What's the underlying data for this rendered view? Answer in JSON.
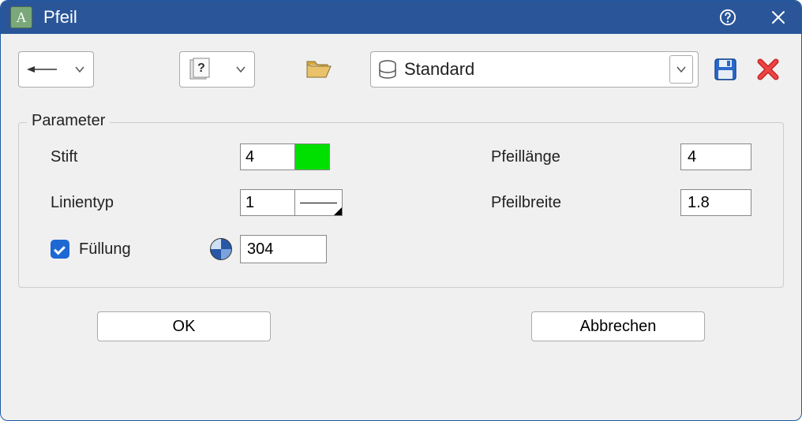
{
  "window": {
    "title": "Pfeil"
  },
  "toolbar": {
    "preset": "Standard"
  },
  "fieldset": {
    "legend": "Parameter",
    "stift_label": "Stift",
    "stift_value": "4",
    "stift_color": "#00e000",
    "linientyp_label": "Linientyp",
    "linientyp_value": "1",
    "fuellung_label": "Füllung",
    "fuellung_checked": true,
    "fuellung_value": "304",
    "pfeillaenge_label": "Pfeillänge",
    "pfeillaenge_value": "4",
    "pfeilbreite_label": "Pfeilbreite",
    "pfeilbreite_value": "1.8"
  },
  "buttons": {
    "ok": "OK",
    "cancel": "Abbrechen"
  }
}
